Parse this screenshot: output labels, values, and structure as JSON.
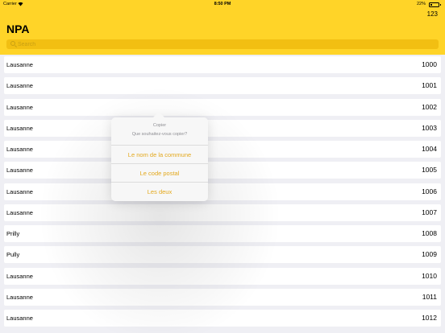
{
  "status_bar": {
    "carrier": "Carrier",
    "time": "8:50 PM",
    "battery_percent": "22%",
    "battery_level": 0.22
  },
  "header": {
    "toggle_label": "123",
    "title": "NPA",
    "search_placeholder": "Search"
  },
  "rows": [
    {
      "name": "Lausanne",
      "code": "1000"
    },
    {
      "name": "Lausanne",
      "code": "1001"
    },
    {
      "name": "Lausanne",
      "code": "1002"
    },
    {
      "name": "Lausanne",
      "code": "1003"
    },
    {
      "name": "Lausanne",
      "code": "1004"
    },
    {
      "name": "Lausanne",
      "code": "1005"
    },
    {
      "name": "Lausanne",
      "code": "1006"
    },
    {
      "name": "Lausanne",
      "code": "1007"
    },
    {
      "name": "Prilly",
      "code": "1008"
    },
    {
      "name": "Pully",
      "code": "1009"
    },
    {
      "name": "Lausanne",
      "code": "1010"
    },
    {
      "name": "Lausanne",
      "code": "1011"
    },
    {
      "name": "Lausanne",
      "code": "1012"
    }
  ],
  "popover": {
    "title": "Copier",
    "message": "Que souhaitez-vous copier?",
    "options": [
      "Le nom de la commune",
      "Le code postal",
      "Les deux"
    ]
  },
  "colors": {
    "header_bg": "#ffd428",
    "search_bg": "#f2bf12",
    "accent": "#e3a81c"
  }
}
